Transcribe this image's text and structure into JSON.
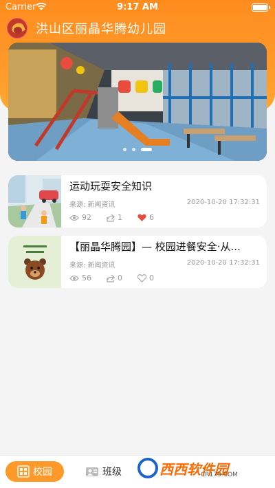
{
  "status_bar": {
    "carrier": "Carrier",
    "time": "9:17 AM"
  },
  "header": {
    "title": "洪山区丽晶华腾幼儿园"
  },
  "banner": {
    "slide_count": 3,
    "active_index": 2
  },
  "news": [
    {
      "title": "运动玩耍安全知识",
      "source": "来源: 新闻资讯",
      "date": "2020-10-20 17:32:31",
      "views": "92",
      "shares": "1",
      "likes": "6",
      "liked": true
    },
    {
      "title": "【丽晶华腾园】— 校园进餐安全·从...",
      "source": "来源: 新闻资讯",
      "date": "2020-10-20 17:32:31",
      "views": "56",
      "shares": "0",
      "likes": "0",
      "liked": false
    }
  ],
  "tabbar": {
    "campus_label": "校园",
    "class_label": "班级"
  },
  "watermark": {
    "brand": "西西软件园",
    "url": "CR173.COM"
  },
  "colors": {
    "accent": "#ff9a2a",
    "like_active": "#e74c3c"
  }
}
